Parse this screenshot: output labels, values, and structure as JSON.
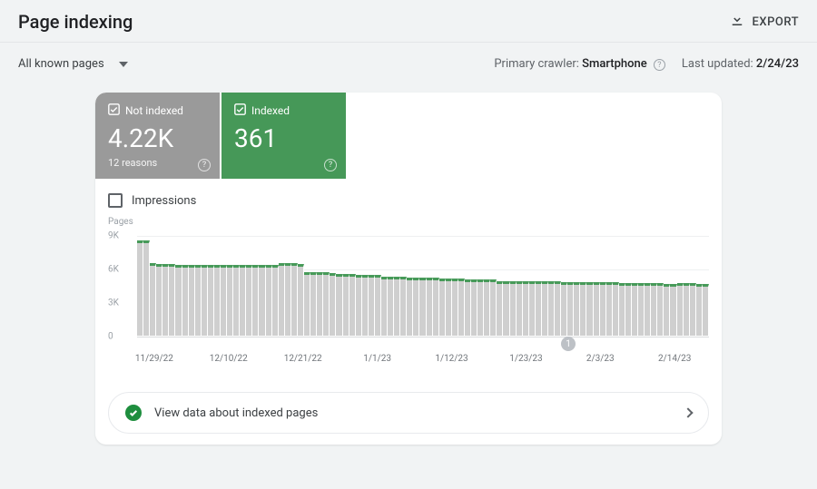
{
  "header": {
    "title": "Page indexing",
    "export_label": "EXPORT"
  },
  "subheader": {
    "filter_label": "All known pages",
    "crawler_prefix": "Primary crawler: ",
    "crawler_value": "Smartphone",
    "updated_prefix": "Last updated: ",
    "updated_value": "2/24/23"
  },
  "tiles": {
    "not_indexed": {
      "label": "Not indexed",
      "value": "4.22K",
      "sub": "12 reasons"
    },
    "indexed": {
      "label": "Indexed",
      "value": "361"
    }
  },
  "impressions_label": "Impressions",
  "y_axis_label": "Pages",
  "y_ticks": [
    "0",
    "3K",
    "6K",
    "9K"
  ],
  "x_ticks": [
    "11/29/22",
    "12/10/22",
    "12/21/22",
    "1/1/23",
    "1/12/23",
    "1/23/23",
    "2/3/23",
    "2/14/23"
  ],
  "marker_label": "1",
  "view_data_label": "View data about indexed pages",
  "chart_data": {
    "type": "bar",
    "title": "",
    "xlabel": "",
    "ylabel": "Pages",
    "ylim": [
      0,
      9000
    ],
    "categories_note": "Daily buckets from ~2022-11-29 to ~2023-02-24 — categories implied by x-axis ticks",
    "series": [
      {
        "name": "Not indexed",
        "color": "#cfcfcf",
        "values": [
          8500,
          8500,
          6500,
          6400,
          6400,
          6400,
          6300,
          6300,
          6300,
          6300,
          6300,
          6300,
          6300,
          6300,
          6300,
          6300,
          6300,
          6300,
          6300,
          6300,
          6300,
          6300,
          6500,
          6500,
          6500,
          6400,
          5700,
          5700,
          5700,
          5700,
          5600,
          5500,
          5500,
          5500,
          5400,
          5400,
          5400,
          5400,
          5300,
          5300,
          5300,
          5300,
          5200,
          5200,
          5200,
          5200,
          5200,
          5100,
          5100,
          5100,
          5100,
          5000,
          5000,
          5000,
          5000,
          5000,
          4900,
          4900,
          4900,
          4850,
          4850,
          4900,
          4900,
          4850,
          4850,
          4850,
          4800,
          4800,
          4800,
          4800,
          4800,
          4800,
          4800,
          4800,
          4800,
          4700,
          4700,
          4700,
          4700,
          4700,
          4700,
          4700,
          4600,
          4600,
          4700,
          4700,
          4700,
          4650,
          4650
        ]
      },
      {
        "name": "Indexed",
        "color": "#479a59",
        "values_note": "Thin constant green cap across all bars, ~361 as shown in tile"
      }
    ],
    "event_markers": [
      {
        "label": "1",
        "x_approx": "2/3/23"
      }
    ]
  }
}
